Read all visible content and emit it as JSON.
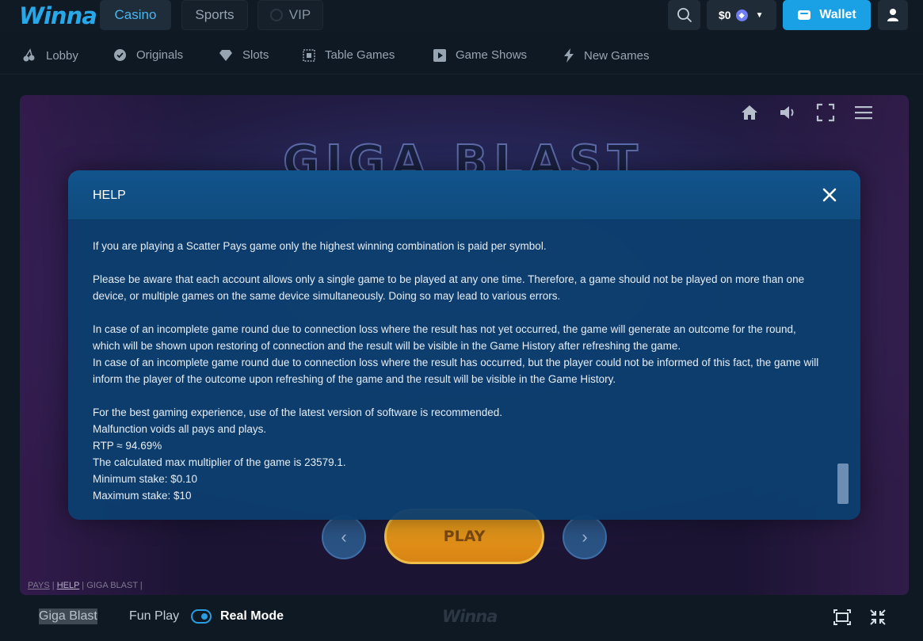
{
  "brand": {
    "logo_text": "Winna"
  },
  "topnav": {
    "tabs": [
      {
        "label": "Casino",
        "active": true
      },
      {
        "label": "Sports"
      },
      {
        "label": "VIP"
      }
    ],
    "balance": "$0",
    "currency_icon": "ethereum-icon",
    "wallet_label": "Wallet"
  },
  "subnav": {
    "items": [
      {
        "label": "Lobby",
        "icon": "cherry-icon"
      },
      {
        "label": "Originals",
        "icon": "badge-check-icon"
      },
      {
        "label": "Slots",
        "icon": "diamond-icon"
      },
      {
        "label": "Table Games",
        "icon": "grid-icon"
      },
      {
        "label": "Game Shows",
        "icon": "play-square-icon"
      },
      {
        "label": "New Games",
        "icon": "lightning-icon"
      }
    ]
  },
  "game": {
    "title_art": "GIGA BLAST",
    "play_label": "PLAY",
    "links": {
      "pays": "PAYS",
      "help": "HELP",
      "name": "GIGA BLAST"
    }
  },
  "help_modal": {
    "title": "HELP",
    "paragraphs": {
      "p1": "If you are playing a Scatter Pays game only the highest winning combination is paid per symbol.",
      "p2": "Please be aware that each account allows only a single game to be played at any one time. Therefore, a game should not be played on more than one device, or multiple games on the same device simultaneously. Doing so may lead to various errors.",
      "p3": "In case of an incomplete game round due to connection loss where the result has not yet occurred, the game will generate an outcome for the round, which will be shown upon restoring of connection and the result will be visible in the Game History after refreshing the game.",
      "p4": "In case of an incomplete game round due to connection loss where the result has occurred, but the player could not be informed of this fact, the game will inform the player of the outcome upon refreshing of the game and the result will be visible in the Game History.",
      "p5": "For the best gaming experience, use of the latest version of software is recommended.",
      "p6": "Malfunction voids all pays and plays.",
      "p7": "RTP ≈ 94.69%",
      "p8": "The calculated max multiplier of the game is 23579.1.",
      "p9": "Minimum stake: $0.10",
      "p10": "Maximum stake: $10"
    }
  },
  "bottombar": {
    "game_name": "Giga Blast",
    "fun_play": "Fun Play",
    "real_mode": "Real Mode",
    "mode_real_on": true,
    "logo_text": "Winna"
  },
  "colors": {
    "accent": "#1aa0e5",
    "background": "#0f1923",
    "modal": "#0d3e6e"
  }
}
